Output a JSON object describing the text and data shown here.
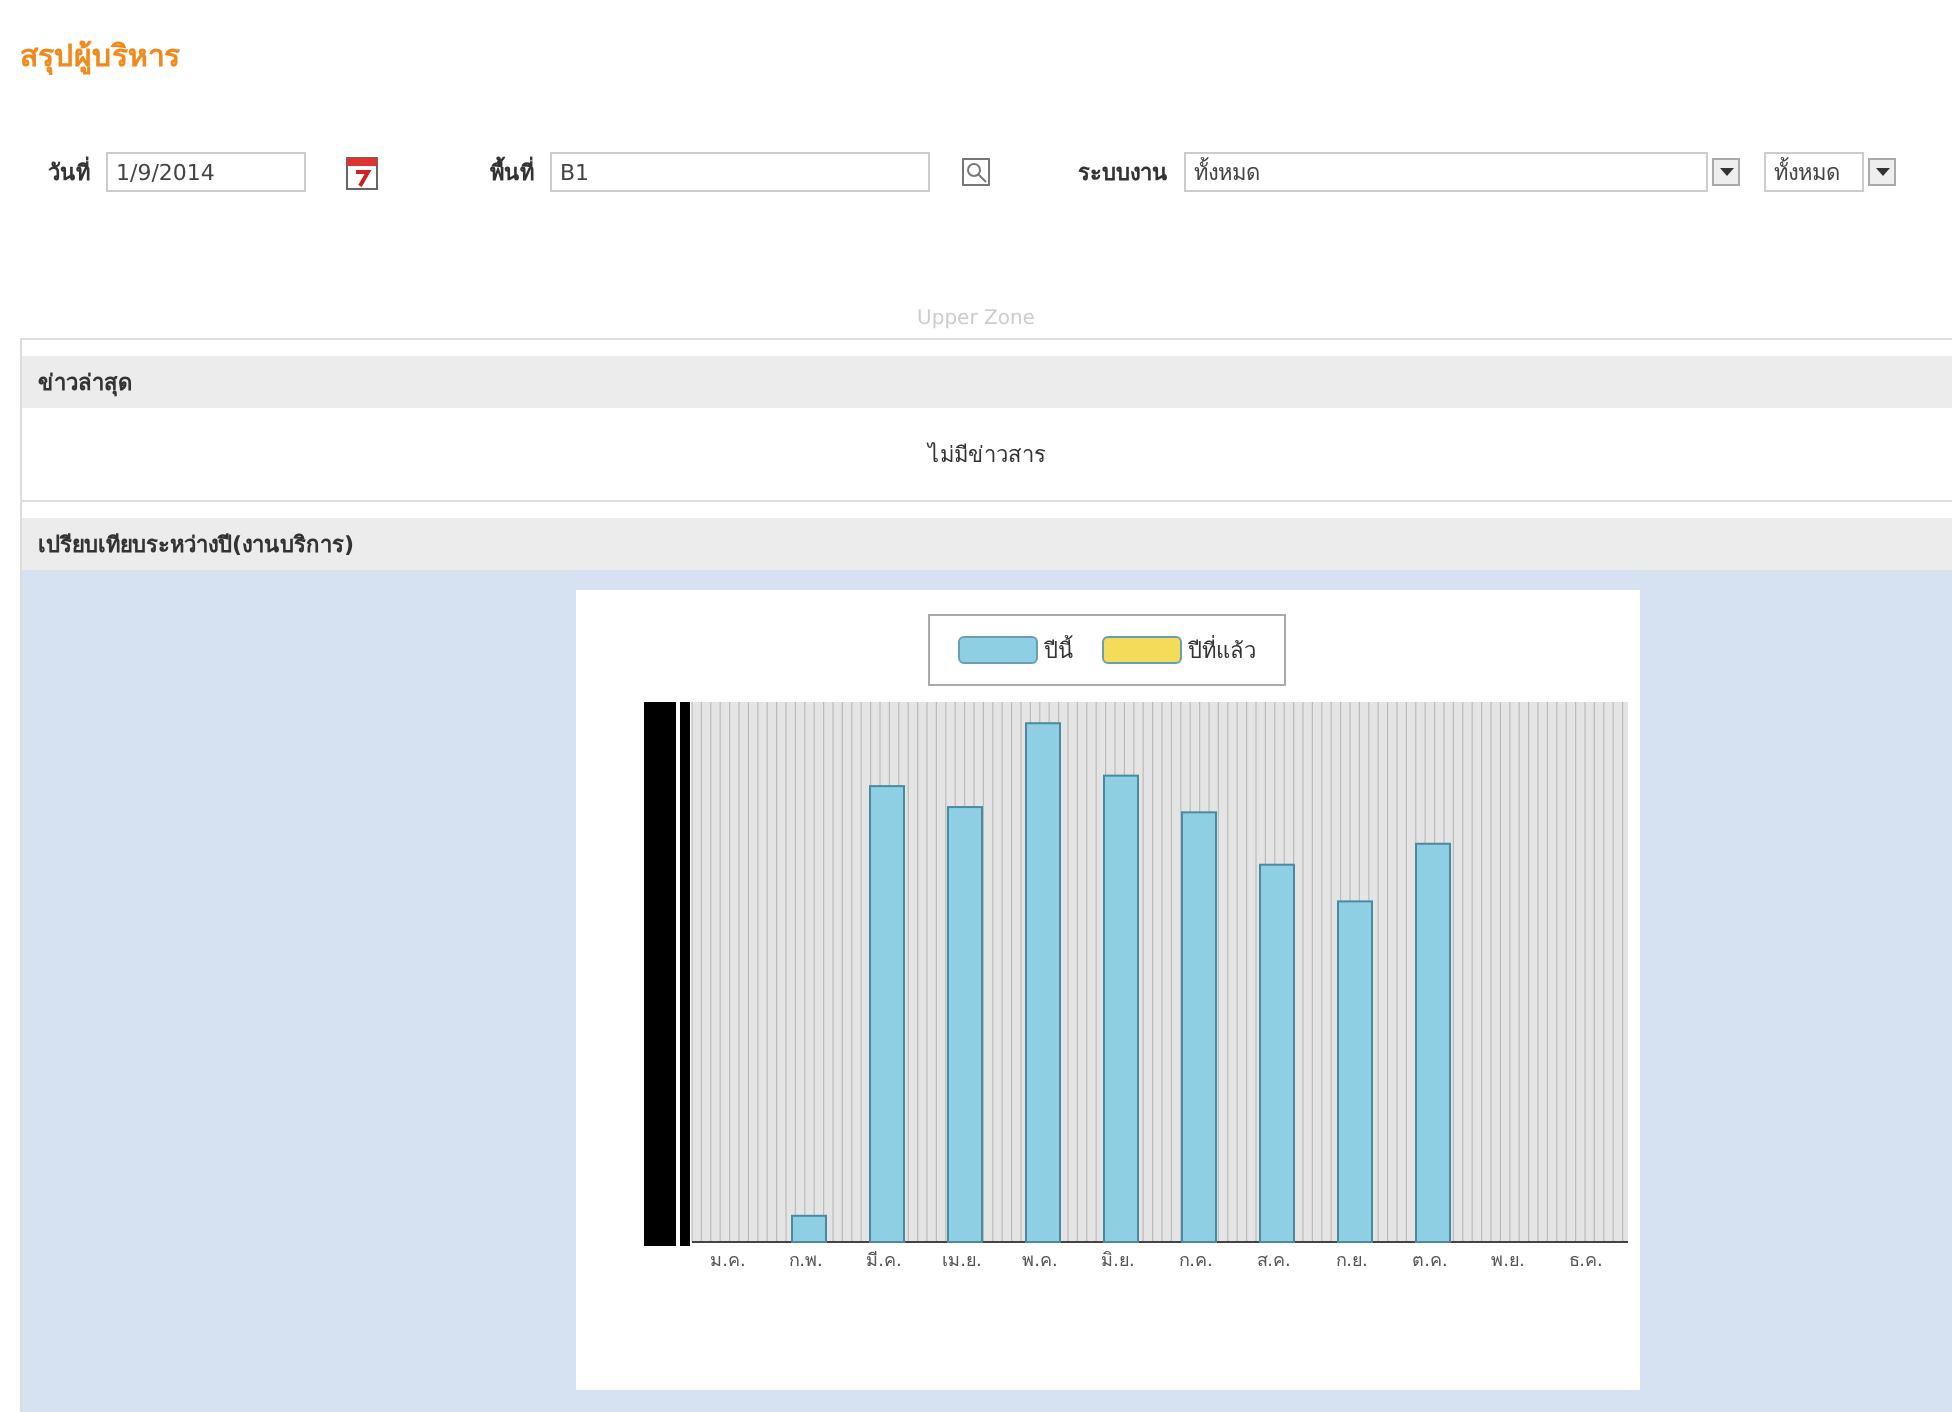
{
  "page_title": "สรุปผู้บริหาร",
  "filters": {
    "date": {
      "label": "วันที่",
      "value": "1/9/2014"
    },
    "area": {
      "label": "พื้นที่",
      "value": "B1"
    },
    "system": {
      "label": "ระบบงาน",
      "value": "ทั้งหมด",
      "sub_value": "ทั้งหมด"
    }
  },
  "zone_caption": "Upper Zone",
  "news": {
    "title": "ข่าวล่าสุด",
    "message": "ไม่มีข่าวสาร"
  },
  "comparison": {
    "title": "เปรียบเทียบระหว่างปี(งานบริการ)",
    "legend": [
      {
        "name": "ปีนี้",
        "color": "#8fcfe3"
      },
      {
        "name": "ปีที่แล้ว",
        "color": "#f2dc5a"
      }
    ],
    "months": [
      "ม.ค.",
      "ก.พ.",
      "มี.ค.",
      "เม.ย.",
      "พ.ค.",
      "มิ.ย.",
      "ก.ค.",
      "ส.ค.",
      "ก.ย.",
      "ต.ค.",
      "พ.ย.",
      "ธ.ค."
    ]
  }
}
